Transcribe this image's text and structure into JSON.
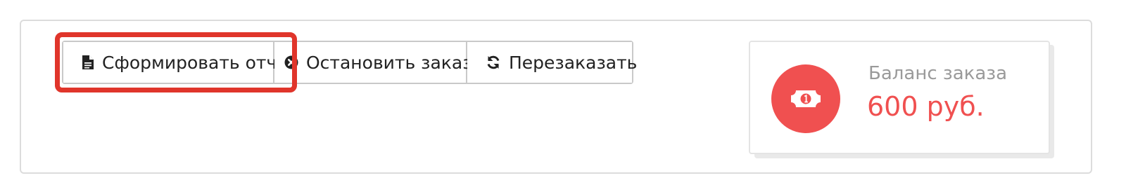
{
  "actions": {
    "report_label": "Сформировать отчет",
    "stop_label": "Остановить заказ",
    "reorder_label": "Перезаказать"
  },
  "balance": {
    "label": "Баланс заказа",
    "value": "600 руб.",
    "icon": "money-bill-icon"
  },
  "colors": {
    "accent": "#f05050",
    "highlight": "#e0352b",
    "border": "#c9c9c9"
  }
}
